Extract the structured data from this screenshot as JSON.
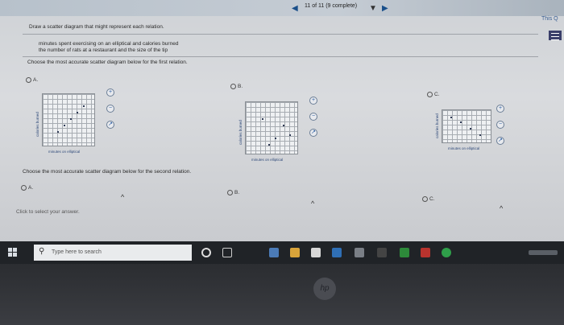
{
  "header": {
    "progress": "11 of 11 (9 complete)",
    "this_question": "This Q"
  },
  "question": {
    "prompt": "Draw a scatter diagram that might represent each relation.",
    "relation_1": "minutes spent exercising on an elliptical and calories burned",
    "relation_2": "the number of rats at a restaurant and the size of the tip",
    "instruction_1": "Choose the most accurate scatter diagram below for the first relation.",
    "instruction_2": "Choose the most accurate scatter diagram below for the second relation.",
    "hint": "Click to select your answer."
  },
  "options_first": [
    {
      "label": "A.",
      "xlabel": "minutes on elliptical",
      "ylabel": "calories burned"
    },
    {
      "label": "B.",
      "xlabel": "minutes on elliptical",
      "ylabel": "calories burned"
    },
    {
      "label": "C.",
      "xlabel": "minutes on elliptical",
      "ylabel": "calories burned"
    }
  ],
  "options_second": [
    {
      "label": "A."
    },
    {
      "label": "B."
    },
    {
      "label": "C."
    }
  ],
  "taskbar": {
    "search_placeholder": "Type here to search"
  },
  "bezel": {
    "logo": "hp"
  },
  "colors": {
    "accent": "#1a4f8a",
    "menu": "#3a3f6a"
  },
  "icons": [
    "zoom-in-icon",
    "zoom-out-icon",
    "popout-icon",
    "windows-start-icon",
    "search-icon"
  ]
}
